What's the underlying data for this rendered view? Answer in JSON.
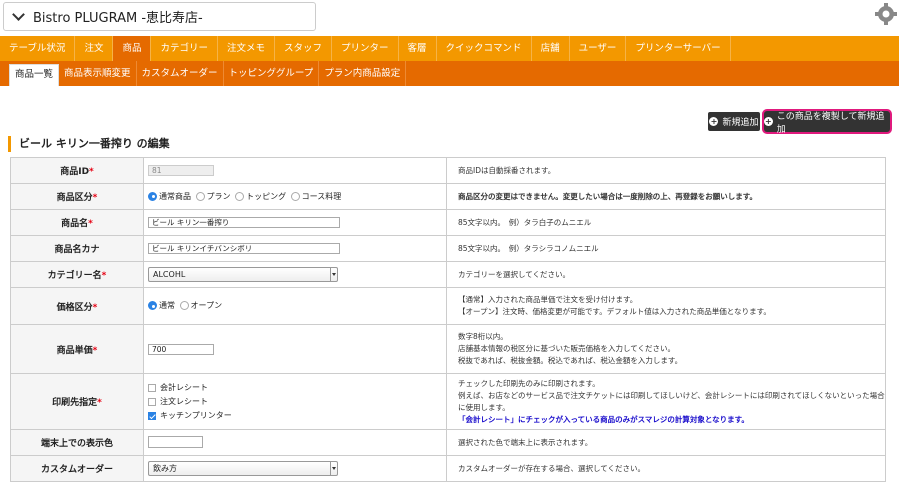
{
  "store": {
    "name": "Bistro PLUGRAM -恵比寿店-"
  },
  "nav_main": [
    "テーブル状況",
    "注文",
    "商品",
    "カテゴリー",
    "注文メモ",
    "スタッフ",
    "プリンター",
    "客層",
    "クイックコマンド",
    "店舗",
    "ユーザー",
    "プリンターサーバー"
  ],
  "nav_main_active": "商品",
  "nav_sub": [
    "商品一覧",
    "商品表示順変更",
    "カスタムオーダー",
    "トッピンググループ",
    "プラン内商品設定"
  ],
  "actions": {
    "add": "新規追加",
    "duplicate": "この商品を複製して新規追加"
  },
  "page_title": "ビール キリン一番搾り の編集",
  "rows": {
    "id": {
      "label": "商品ID",
      "value": "81",
      "help": "商品IDは自動採番されます。"
    },
    "kind": {
      "label": "商品区分",
      "options": [
        "通常商品",
        "プラン",
        "トッピング",
        "コース料理"
      ],
      "selected": "通常商品",
      "help": "商品区分の変更はできません。変更したい場合は一度削除の上、再登録をお願いします。"
    },
    "name": {
      "label": "商品名",
      "value": "ビール キリン一番搾り",
      "help": "85文字以内。　例）タラ白子のムニエル"
    },
    "kana": {
      "label": "商品名カナ",
      "value": "ビール キリンイチバンシボリ",
      "help": "85文字以内。　例）タラシラコノムニエル"
    },
    "category": {
      "label": "カテゴリー名",
      "value": "ALCOHL",
      "help": "カテゴリーを選択してください。"
    },
    "price_type": {
      "label": "価格区分",
      "options": [
        "通常",
        "オープン"
      ],
      "selected": "通常",
      "help1": "【通常】入力された商品単価で注文を受け付けます。",
      "help2": "【オープン】注文時、価格変更が可能です。デフォルト値は入力された商品単価となります。"
    },
    "price": {
      "label": "商品単価",
      "value": "700",
      "help1": "数字8桁以内。",
      "help2": "店舗基本情報の税区分に基づいた販売価格を入力してください。",
      "help3": "税抜であれば、税抜金額。税込であれば、税込金額を入力します。"
    },
    "printer": {
      "label": "印刷先指定",
      "options": [
        {
          "label": "会計レシート",
          "checked": false
        },
        {
          "label": "注文レシート",
          "checked": false
        },
        {
          "label": "キッチンプリンター",
          "checked": true
        }
      ],
      "help1": "チェックした印刷先のみに印刷されます。",
      "help2": "例えば、お店などのサービス品で注文チケットには印刷してほしいけど、会計レシートには印刷されてほしくないといった場合に使用します。",
      "help3": "「会計レシート」にチェックが入っている商品のみがスマレジの計算対象となります。"
    },
    "color": {
      "label": "端末上での表示色",
      "value": "",
      "help": "選択された色で端末上に表示されます。"
    },
    "custom": {
      "label": "カスタムオーダー",
      "value": "飲み方",
      "help": "カスタムオーダーが存在する場合、選択してください。"
    }
  }
}
